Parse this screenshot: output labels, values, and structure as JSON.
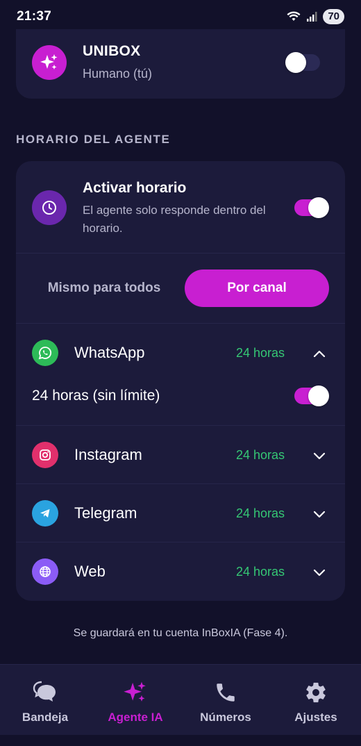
{
  "status_bar": {
    "time": "21:37",
    "battery": "70"
  },
  "agent_card": {
    "title": "UNIBOX",
    "subtitle": "Humano (tú)",
    "toggle_state": "off"
  },
  "schedule": {
    "section_label": "HORARIO DEL AGENTE",
    "activate_title": "Activar horario",
    "activate_desc": "El agente solo responde dentro del horario.",
    "activate_toggle": "on",
    "segment": {
      "left_label": "Mismo para todos",
      "right_label": "Por canal",
      "selected": "Por canal"
    },
    "channels": [
      {
        "name": "WhatsApp",
        "hours": "24 horas",
        "icon": "whatsapp-icon",
        "color": "#2dbb58",
        "expanded": true
      },
      {
        "name": "Instagram",
        "hours": "24 horas",
        "icon": "instagram-icon",
        "color": "#e1306c",
        "expanded": false
      },
      {
        "name": "Telegram",
        "hours": "24 horas",
        "icon": "telegram-icon",
        "color": "#2aa3e0",
        "expanded": false
      },
      {
        "name": "Web",
        "hours": "24 horas",
        "icon": "globe-icon",
        "color": "#8b5cf6",
        "expanded": false
      }
    ],
    "whatsapp_detail": {
      "label": "24 horas (sin límite)",
      "toggle": "on"
    }
  },
  "footer_note": "Se guardará en tu cuenta InBoxIA (Fase 4).",
  "bottom_nav": [
    {
      "label": "Bandeja",
      "icon": "chat-bubbles-icon",
      "active": false
    },
    {
      "label": "Agente IA",
      "icon": "sparkles-icon",
      "active": true
    },
    {
      "label": "Números",
      "icon": "phone-icon",
      "active": false
    },
    {
      "label": "Ajustes",
      "icon": "gear-icon",
      "active": false
    }
  ],
  "colors": {
    "accent": "#c81fd1",
    "background": "#12112a",
    "card": "#1c1b3b",
    "hours_green": "#35c774"
  }
}
